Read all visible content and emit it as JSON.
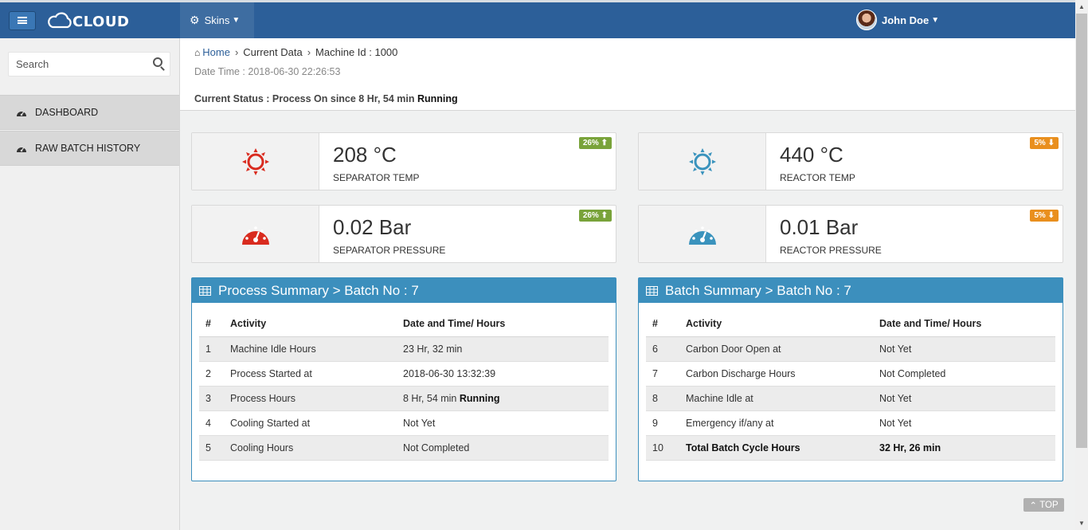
{
  "app": {
    "logo_text": "CLOUD"
  },
  "topbar": {
    "skins_label": "Skins",
    "user_name": "John Doe"
  },
  "sidebar": {
    "search_placeholder": "Search",
    "items": [
      {
        "label": "DASHBOARD",
        "icon": "dashboard-icon"
      },
      {
        "label": "RAW BATCH HISTORY",
        "icon": "dashboard-icon"
      }
    ]
  },
  "breadcrumb": {
    "home": "Home",
    "current": "Current Data",
    "machine": "Machine Id : 1000"
  },
  "datetime": "Date Time : 2018-06-30 22:26:53",
  "status": {
    "prefix": "Current Status : Process On since 8 Hr, 54 min",
    "state": "Running"
  },
  "cards": [
    {
      "value": "208 °C",
      "label": "SEPARATOR TEMP",
      "badge": "26%",
      "trend": "up",
      "icon": "sun-icon",
      "color": "#d92b1f"
    },
    {
      "value": "440 °C",
      "label": "REACTOR TEMP",
      "badge": "5%",
      "trend": "down",
      "icon": "sun-icon",
      "color": "#3a93bd"
    },
    {
      "value": "0.02 Bar",
      "label": "SEPARATOR PRESSURE",
      "badge": "26%",
      "trend": "up",
      "icon": "gauge-icon",
      "color": "#d92b1f"
    },
    {
      "value": "0.01 Bar",
      "label": "REACTOR PRESSURE",
      "badge": "5%",
      "trend": "down",
      "icon": "gauge-icon",
      "color": "#3a93bd"
    }
  ],
  "process_summary": {
    "title": "Process Summary > Batch No : 7",
    "headers": [
      "#",
      "Activity",
      "Date and Time/ Hours"
    ],
    "rows": [
      {
        "num": "1",
        "activity": "Machine Idle Hours",
        "value": "23 Hr, 32 min",
        "extra": ""
      },
      {
        "num": "2",
        "activity": "Process Started at",
        "value": "2018-06-30 13:32:39",
        "extra": ""
      },
      {
        "num": "3",
        "activity": "Process Hours",
        "value": "8 Hr, 54 min",
        "extra": "Running"
      },
      {
        "num": "4",
        "activity": "Cooling Started at",
        "value": "Not Yet",
        "extra": ""
      },
      {
        "num": "5",
        "activity": "Cooling Hours",
        "value": "Not Completed",
        "extra": ""
      }
    ]
  },
  "batch_summary": {
    "title": "Batch Summary > Batch No : 7",
    "headers": [
      "#",
      "Activity",
      "Date and Time/ Hours"
    ],
    "rows": [
      {
        "num": "6",
        "activity": "Carbon Door Open at",
        "value": "Not Yet",
        "bold": false
      },
      {
        "num": "7",
        "activity": "Carbon Discharge Hours",
        "value": "Not Completed",
        "bold": false
      },
      {
        "num": "8",
        "activity": "Machine Idle at",
        "value": "Not Yet",
        "bold": false
      },
      {
        "num": "9",
        "activity": "Emergency if/any at",
        "value": "Not Yet",
        "bold": false
      },
      {
        "num": "10",
        "activity": "Total Batch Cycle Hours",
        "value": "32 Hr, 26 min",
        "bold": true
      }
    ]
  },
  "top_button": "TOP"
}
